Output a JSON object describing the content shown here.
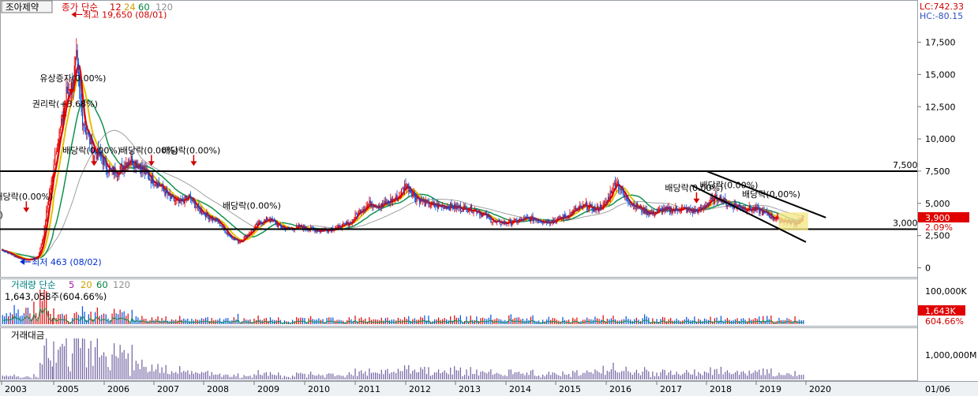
{
  "header": {
    "stock_name": "조아제약",
    "price_label": "종가 단순",
    "ma": [
      "12",
      "24",
      "60",
      "120"
    ],
    "lc": "LC:742.33",
    "hc": "HC:-80.15"
  },
  "volume_header": {
    "label": "거래량 단순",
    "ma": [
      "5",
      "20",
      "60",
      "120"
    ],
    "last": "1,643,058주(604.66%)"
  },
  "amount_header": {
    "label": "거래대금"
  },
  "colors": {
    "candle_up": "#e00000",
    "candle_down": "#0050e0",
    "ma12": "#e00000",
    "ma24": "#e0c000",
    "ma60": "#109050",
    "ma120": "#a0a0a0",
    "header_red": "#d00000",
    "header_yellow": "#d0a000",
    "header_green": "#008040",
    "header_gray": "#909090",
    "volume_label": "#008080",
    "amount_bar": "#7060a0",
    "price_box": "#e00000",
    "highlight": "#f5e88a"
  },
  "chart_data": [
    {
      "type": "candlestick",
      "title": "조아제약",
      "x_axis_labels": [
        "2003",
        "2005",
        "2006",
        "2007",
        "2008",
        "2009",
        "2010",
        "2011",
        "2012",
        "2013",
        "2014",
        "2015",
        "2016",
        "2017",
        "2018",
        "2019",
        "2020",
        "01/06"
      ],
      "y_ticks": [
        "17,500",
        "15,000",
        "12,500",
        "10,000",
        "7,500",
        "5,000",
        "2,500",
        "0"
      ],
      "ylim": [
        -200,
        20200
      ],
      "grid": false,
      "series": [
        {
          "name": "close",
          "x": [
            2003.0,
            2003.3,
            2003.6,
            2003.9,
            2004.2,
            2004.4,
            2004.6,
            2004.8,
            2004.95,
            2005.05,
            2005.15,
            2005.25,
            2005.35,
            2005.45,
            2005.55,
            2005.65,
            2005.8,
            2005.95,
            2006.1,
            2006.3,
            2006.5,
            2006.7,
            2006.9,
            2007.1,
            2007.3,
            2007.5,
            2007.7,
            2007.9,
            2008.1,
            2008.3,
            2008.5,
            2008.7,
            2008.9,
            2009.1,
            2009.3,
            2009.5,
            2009.7,
            2009.9,
            2010.1,
            2010.3,
            2010.5,
            2010.7,
            2010.9,
            2011.1,
            2011.3,
            2011.5,
            2011.7,
            2011.85,
            2012.0,
            2012.2,
            2012.4,
            2012.6,
            2012.8,
            2013.0,
            2013.2,
            2013.4,
            2013.6,
            2013.8,
            2014.0,
            2014.2,
            2014.4,
            2014.6,
            2014.8,
            2015.0,
            2015.2,
            2015.4,
            2015.6,
            2015.8,
            2016.0,
            2016.1,
            2016.2,
            2016.35,
            2016.5,
            2016.7,
            2016.9,
            2017.1,
            2017.3,
            2017.5,
            2017.7,
            2017.9,
            2018.0,
            2018.1,
            2018.25,
            2018.4,
            2018.6,
            2018.8,
            2019.0,
            2019.2,
            2019.4,
            2019.6,
            2019.8,
            2019.95
          ],
          "values": [
            1400,
            1100,
            800,
            600,
            700,
            900,
            2500,
            5500,
            7000,
            9500,
            11000,
            13500,
            14000,
            16000,
            12000,
            10500,
            9000,
            8500,
            7500,
            7500,
            8500,
            8000,
            7000,
            6500,
            5500,
            5000,
            5500,
            4500,
            4000,
            3500,
            2500,
            2000,
            2700,
            3500,
            3800,
            3200,
            3000,
            3200,
            3000,
            2900,
            3000,
            3200,
            3500,
            4500,
            5000,
            4800,
            5200,
            5500,
            6500,
            5500,
            5000,
            4800,
            4800,
            4700,
            4600,
            4500,
            4000,
            3500,
            3500,
            3600,
            3800,
            3800,
            3600,
            3700,
            4000,
            4500,
            4800,
            4500,
            5000,
            6000,
            6800,
            5500,
            5000,
            4500,
            4200,
            4500,
            4500,
            4600,
            4400,
            4500,
            5000,
            5200,
            5500,
            5000,
            4800,
            4600,
            4500,
            4200,
            3800,
            3600,
            3500,
            3900
          ]
        },
        {
          "name": "12",
          "type": "line",
          "smoothing": "ma12"
        },
        {
          "name": "24",
          "type": "line",
          "smoothing": "ma24"
        },
        {
          "name": "60",
          "type": "line",
          "smoothing": "ma60"
        },
        {
          "name": "120",
          "type": "line",
          "smoothing": "ma120"
        }
      ],
      "horizontal_lines": [
        {
          "value": 7500,
          "label": "7,500"
        },
        {
          "value": 3000,
          "label": "3,000"
        }
      ],
      "trend_channel": [
        {
          "from": [
            2018.0,
            7500
          ],
          "to": [
            2020.4,
            3900
          ]
        },
        {
          "from": [
            2017.7,
            6400
          ],
          "to": [
            2020.0,
            2000
          ]
        }
      ],
      "annotations": [
        {
          "text": "최고 19,650 (08/01)",
          "x": 2005.35,
          "y": 19650,
          "marker": "left-arrow-red"
        },
        {
          "text": "최저 463 (08/02)",
          "x": 2003.7,
          "y": 463,
          "marker": "left-arrow-blue"
        },
        {
          "text": "유상증자(0.00%)",
          "x": 2005.35,
          "y": 13500,
          "marker": "down-arrow-red"
        },
        {
          "text": "권리락(+3.68%)",
          "x": 2005.2,
          "y": 11500,
          "marker": "down-arrow-red"
        },
        {
          "text": "배당락(0.00%)",
          "x": 2005.8,
          "y": 7900,
          "marker": "down-arrow-red"
        },
        {
          "text": "배당락(0.00%)",
          "x": 2006.95,
          "y": 7900,
          "marker": "down-arrow-red"
        },
        {
          "text": "배당락(0.00%)",
          "x": 2007.8,
          "y": 7900,
          "marker": "down-arrow-red"
        },
        {
          "text": "배당락(0.00%)",
          "x": 2003.95,
          "y": 4300,
          "marker": "down-arrow-red"
        },
        {
          "text": "배당락(0.00%)",
          "x": 2009.0,
          "y": 3600,
          "marker": "none"
        },
        {
          "text": "배당락(0.00%)",
          "x": 2017.8,
          "y": 5000,
          "marker": "down-arrow-red"
        },
        {
          "text": "배당락(0.00%)",
          "x": 2018.5,
          "y": 5200,
          "marker": "none"
        },
        {
          "text": "배당락(0.00%)",
          "x": 2019.35,
          "y": 4500,
          "marker": "none"
        },
        {
          "text": "(0.00%)",
          "x": 2002.95,
          "y": 2900,
          "marker": "none"
        }
      ],
      "last_price": {
        "value": 3900,
        "label": "3,900",
        "change": "2.09%"
      }
    },
    {
      "type": "bar",
      "title": "거래량",
      "y_ticks": [
        "100,000K"
      ],
      "last_value": {
        "label": "1,643K",
        "change": "604.66%"
      }
    },
    {
      "type": "bar",
      "title": "거래대금",
      "y_ticks": [
        "1,000,000M"
      ]
    }
  ]
}
